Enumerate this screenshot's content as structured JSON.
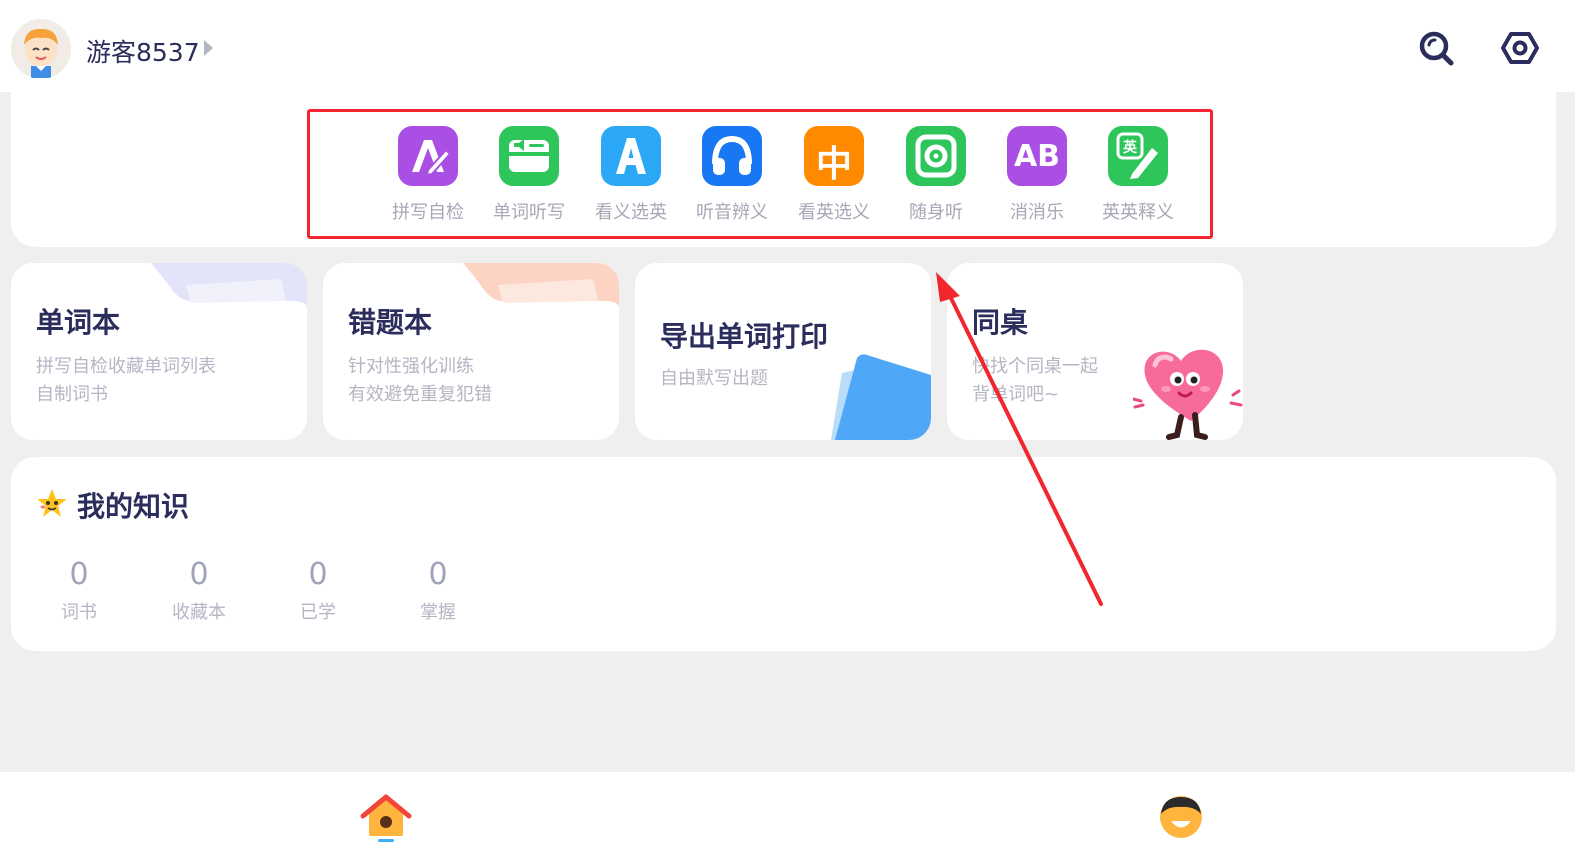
{
  "header": {
    "username": "游客8537",
    "search_icon": "search-icon",
    "settings_icon": "settings-icon"
  },
  "features": [
    {
      "label": "拼写自检",
      "icon": "spelling-icon",
      "color": "#a94fe3"
    },
    {
      "label": "单词听写",
      "icon": "dictation-icon",
      "color": "#2ec65a"
    },
    {
      "label": "看义选英",
      "icon": "letter-a-icon",
      "color": "#2aa8f5"
    },
    {
      "label": "听音辨义",
      "icon": "headphones-icon",
      "color": "#1877f2"
    },
    {
      "label": "看英选义",
      "icon": "chinese-char-icon",
      "color": "#ff8a00",
      "glyph": "中"
    },
    {
      "label": "随身听",
      "icon": "speaker-icon",
      "color": "#2ec65a"
    },
    {
      "label": "消消乐",
      "icon": "ab-match-icon",
      "color": "#a94fe3",
      "glyph": "AB"
    },
    {
      "label": "英英释义",
      "icon": "english-definition-icon",
      "color": "#2ec65a",
      "glyph": "英"
    }
  ],
  "tiles": [
    {
      "title": "单词本",
      "lines": [
        "拼写自检收藏单词列表",
        "自制词书"
      ]
    },
    {
      "title": "错题本",
      "lines": [
        "针对性强化训练",
        "有效避免重复犯错"
      ]
    },
    {
      "title": "导出单词打印",
      "lines": [
        "自由默写出题"
      ]
    },
    {
      "title": "同桌",
      "lines": [
        "快找个同桌一起",
        "背单词吧~"
      ]
    }
  ],
  "knowledge": {
    "title": "我的知识",
    "stats": [
      {
        "value": "0",
        "label": "词书"
      },
      {
        "value": "0",
        "label": "收藏本"
      },
      {
        "value": "0",
        "label": "已学"
      },
      {
        "value": "0",
        "label": "掌握"
      }
    ]
  },
  "nav": {
    "home_icon": "home-icon",
    "profile_icon": "profile-icon"
  },
  "colors": {
    "highlight": "#f2262f",
    "title": "#2b2d5c",
    "muted": "#b5b6c4"
  }
}
